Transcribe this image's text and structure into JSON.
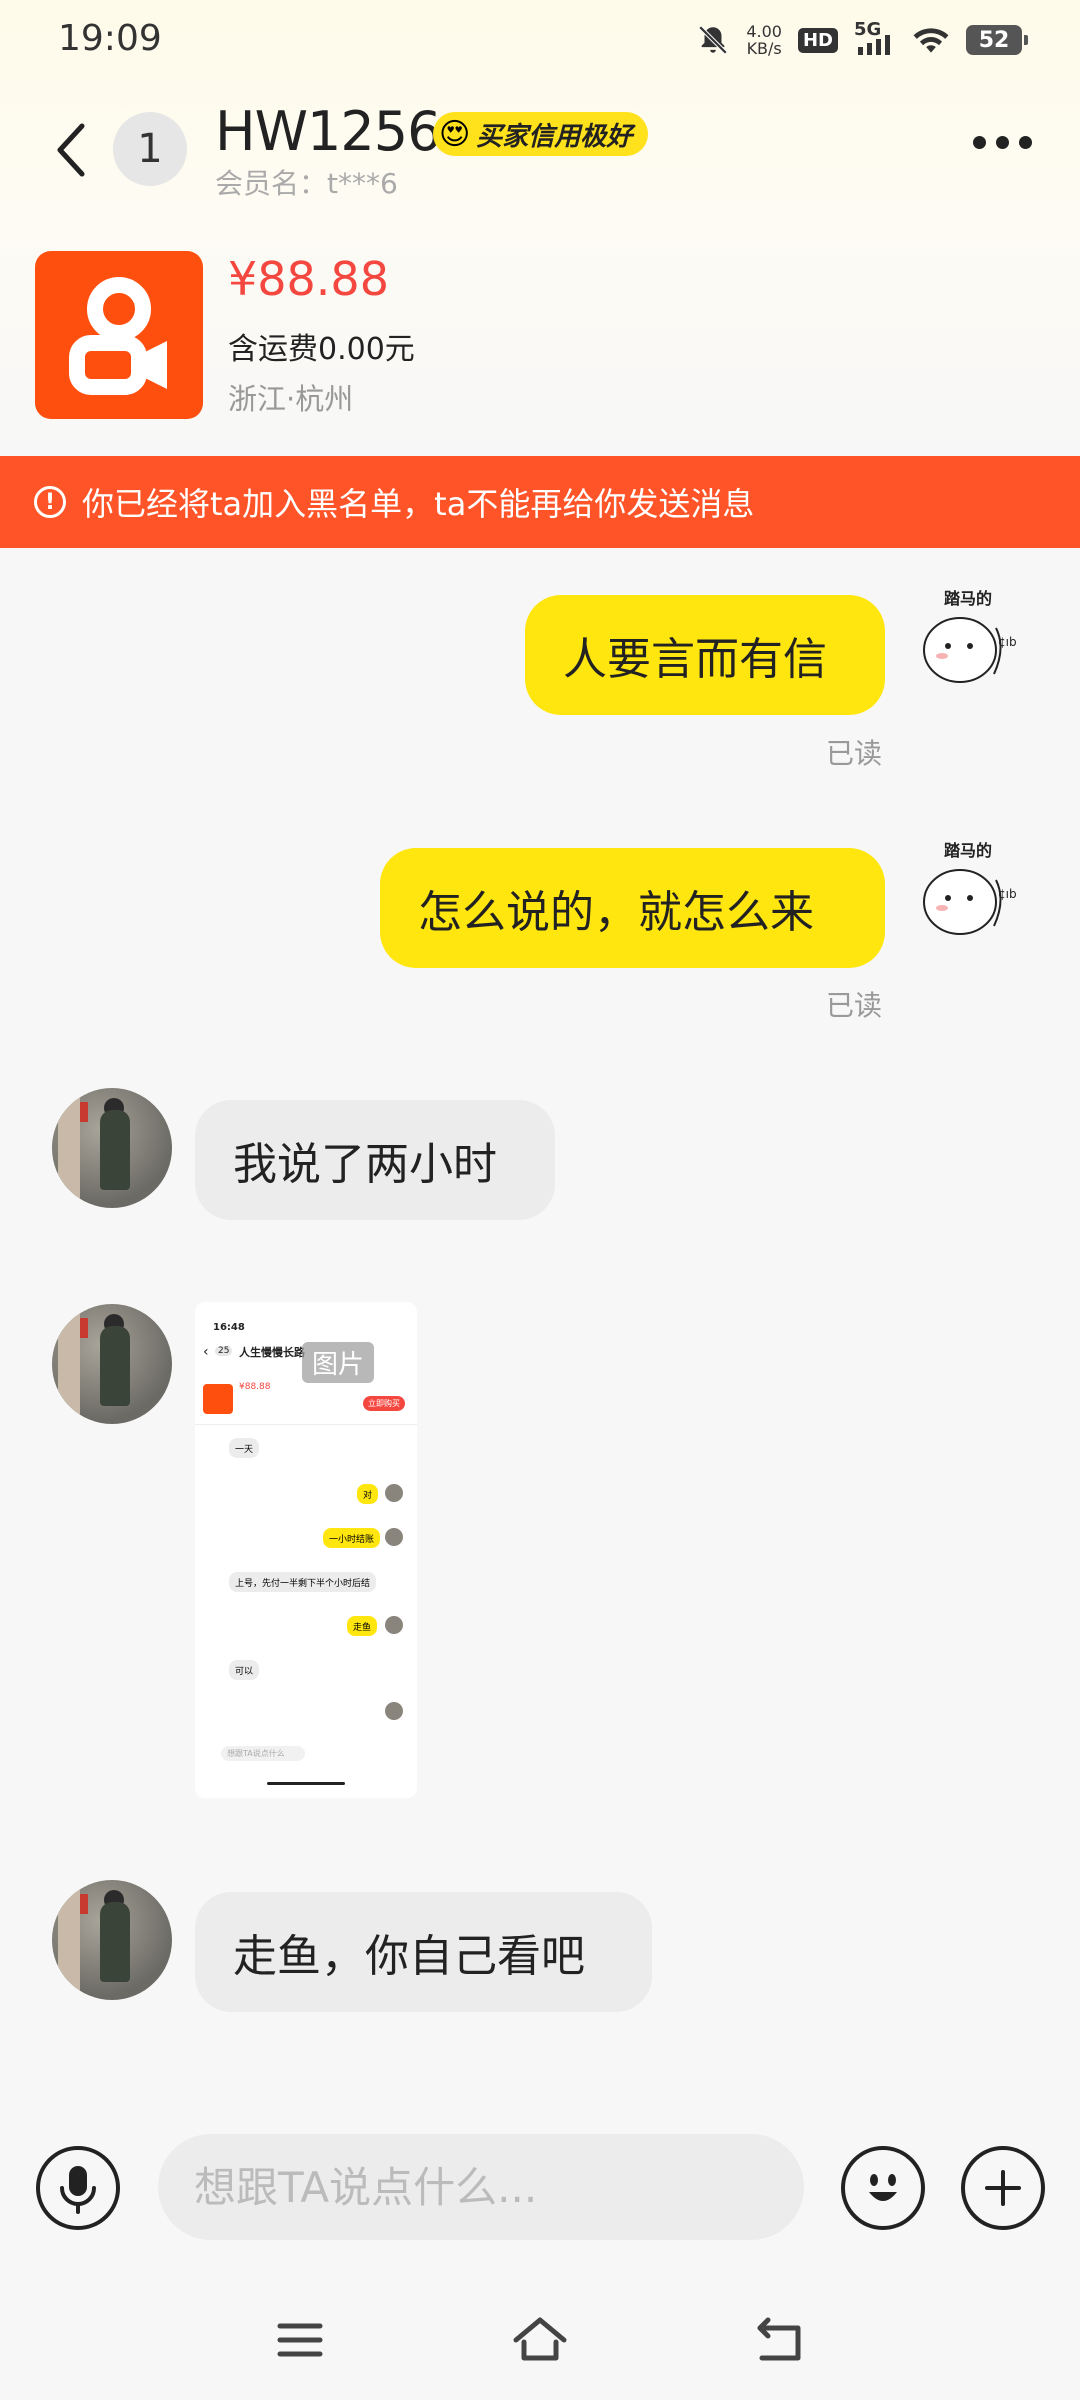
{
  "status_bar": {
    "time": "19:09",
    "net_speed_value": "4.00",
    "net_speed_unit": "KB/s",
    "hd": "HD",
    "network": "5G",
    "battery": "52"
  },
  "header": {
    "unread_count": "1",
    "title": "HW1256",
    "credit_badge": "买家信用极好",
    "member_name": "会员名：t***6"
  },
  "product": {
    "price": "¥88.88",
    "shipping": "含运费0.00元",
    "location": "浙江·杭州"
  },
  "banner": {
    "text": "你已经将ta加入黑名单，ta不能再给你发送消息"
  },
  "messages": [
    {
      "side": "out",
      "text": "人要言而有信",
      "status": "已读",
      "sticker_caption": "踏马的"
    },
    {
      "side": "out",
      "text": "怎么说的，就怎么来",
      "status": "已读",
      "sticker_caption": "踏马的"
    },
    {
      "side": "in",
      "text": "我说了两小时"
    },
    {
      "side": "in",
      "image_label": "图片"
    },
    {
      "side": "in",
      "text": "走鱼，你自己看吧"
    }
  ],
  "image_message": {
    "time": "16:48",
    "count": "25",
    "title": "人生慢慢长路",
    "price": "¥88.88",
    "button": "立即购买",
    "rows": [
      "一天",
      "对",
      "一小时结账",
      "上号，先付一半剩下半个小时后结",
      "走鱼",
      "可以"
    ],
    "input_placeholder": "想跟TA说点什么"
  },
  "input": {
    "placeholder": "想跟TA说点什么..."
  },
  "colors": {
    "accent_yellow": "#ffe60f",
    "banner_orange": "#ff5428",
    "price_red": "#f4473f",
    "brand_orange": "#ff4f0e"
  }
}
